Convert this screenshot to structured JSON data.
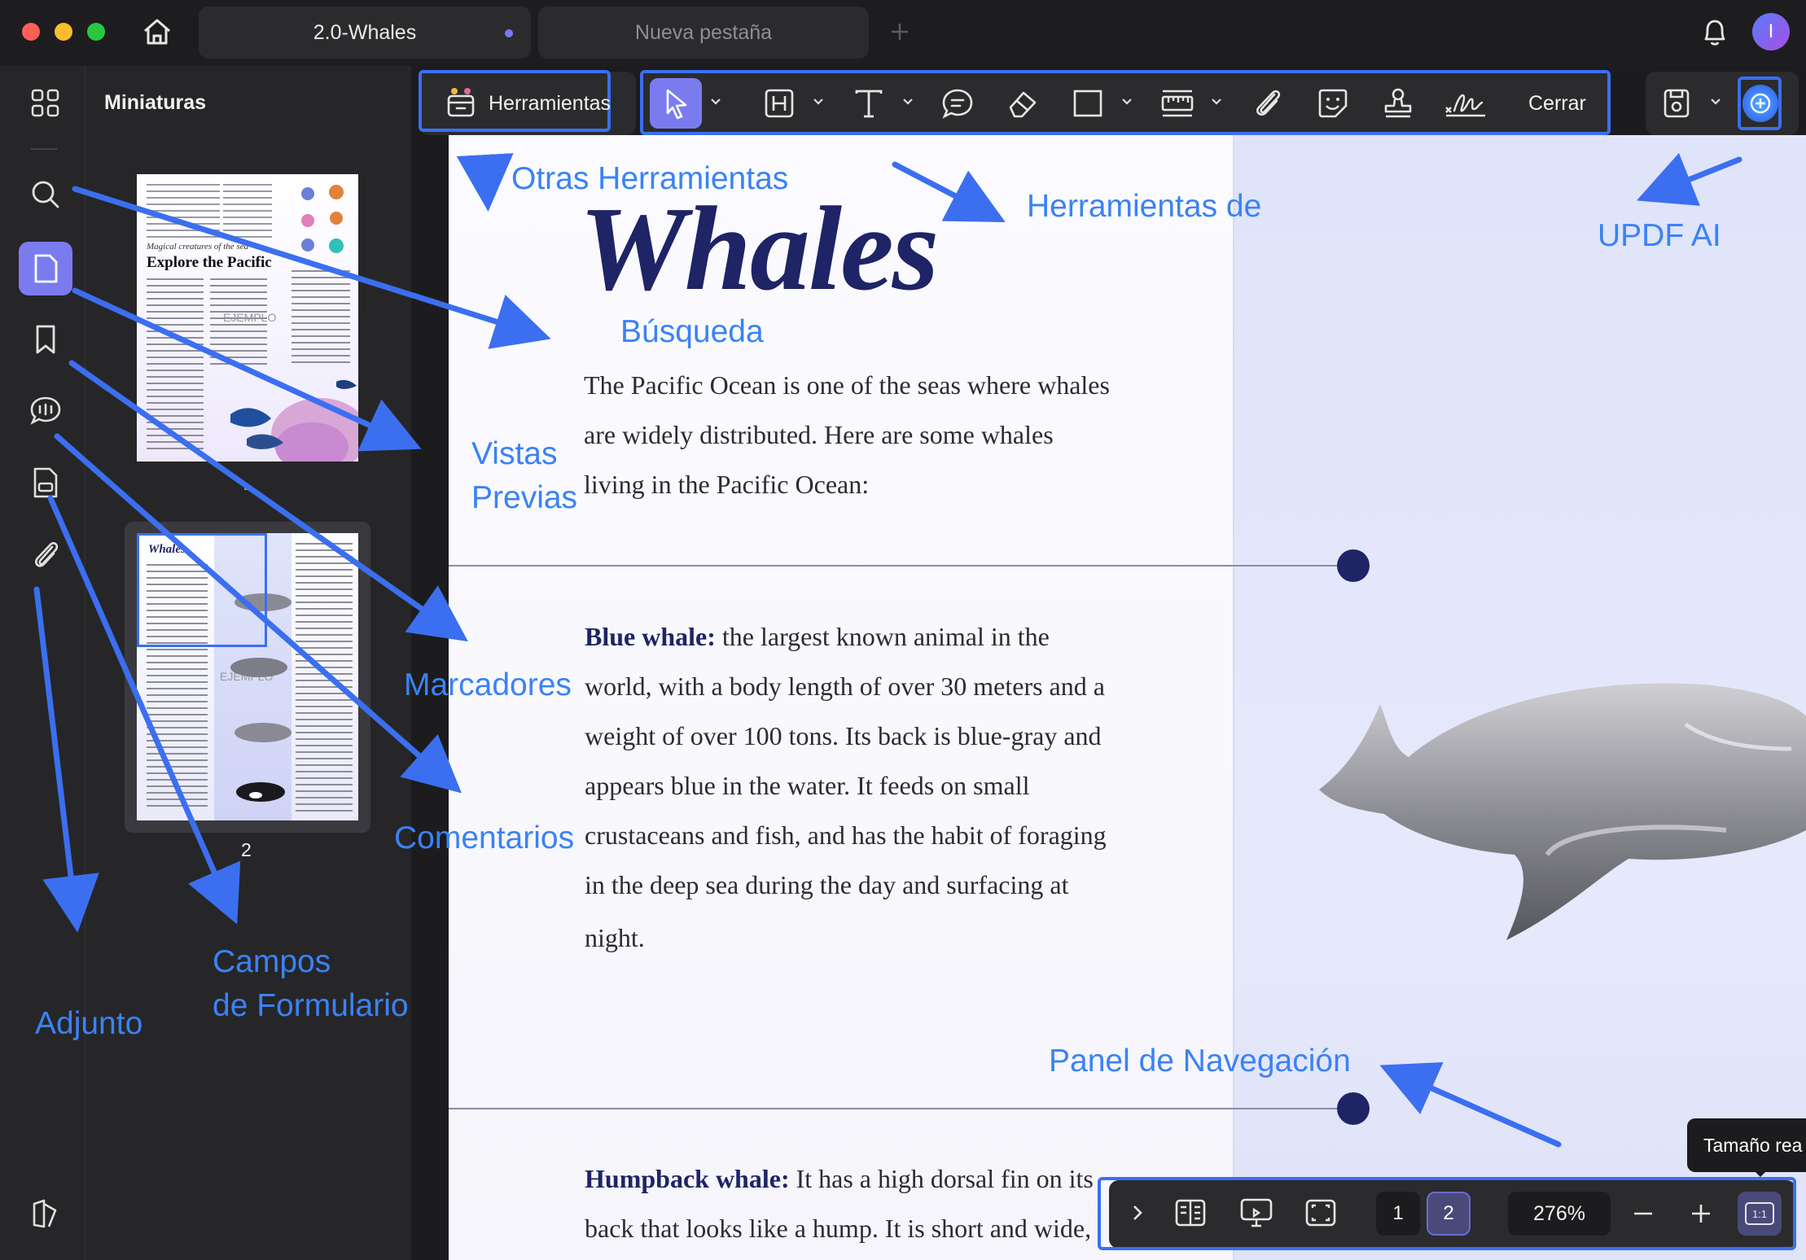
{
  "window": {
    "tabs": [
      {
        "label": "2.0-Whales",
        "active": true
      },
      {
        "label": "Nueva pestaña",
        "active": false
      }
    ],
    "avatar_letter": "I"
  },
  "sidebar": {
    "panel_title": "Miniaturas",
    "items": [
      {
        "name": "thumbnails"
      },
      {
        "name": "search"
      },
      {
        "name": "pages"
      },
      {
        "name": "bookmarks"
      },
      {
        "name": "comments"
      },
      {
        "name": "form-fields"
      },
      {
        "name": "attachments"
      },
      {
        "name": "layers"
      }
    ],
    "thumbnails": [
      {
        "page": "1",
        "heading": "Explore the Pacific",
        "subheading": "Magical creatures of the sea",
        "watermark": "EJEMPLO"
      },
      {
        "page": "2",
        "heading": "Whales",
        "watermark": "EJEMPLO"
      }
    ]
  },
  "toolbar": {
    "tools_label": "Herramientas",
    "close_label": "Cerrar"
  },
  "document": {
    "title": "Whales",
    "intro": [
      "The Pacific Ocean is one of the seas where whales",
      "are widely distributed. Here are some whales",
      "living in the Pacific Ocean:"
    ],
    "blue_whale_title": "Blue whale:",
    "blue_whale_lines": [
      " the largest known animal in the",
      "world, with a body length of over 30 meters and a",
      "weight of over 100 tons. Its back is blue-gray and",
      "appears blue in the water. It feeds on small",
      "crustaceans and fish, and has the habit of foraging",
      "in the deep sea during the day and surfacing at",
      "night."
    ],
    "humpback_title": "Humpback whale:",
    "humpback_lines": [
      " It has a high dorsal fin on its",
      "back that looks like a hump. It is short and wide,"
    ]
  },
  "annotations": {
    "otras": "Otras Herramientas",
    "herramientas_de": "Herramientas de",
    "updf_ai": "UPDF AI",
    "busqueda": "Búsqueda",
    "vistas": "Vistas",
    "previas": "Previas",
    "marcadores": "Marcadores",
    "comentarios": "Comentarios",
    "campos": "Campos",
    "de_formulario": "de Formulario",
    "adjunto": "Adjunto",
    "panel_nav": "Panel de Navegación"
  },
  "bottom_bar": {
    "pages": [
      "1",
      "2"
    ],
    "current_page": "2",
    "zoom": "276%",
    "actual_size_label": "1:1",
    "tooltip": "Tamaño rea"
  },
  "colors": {
    "accent": "#3b6ff0",
    "active_icon_bg": "#7b7bf0",
    "annotation": "#3b82f6",
    "title_navy": "#1f2466"
  }
}
